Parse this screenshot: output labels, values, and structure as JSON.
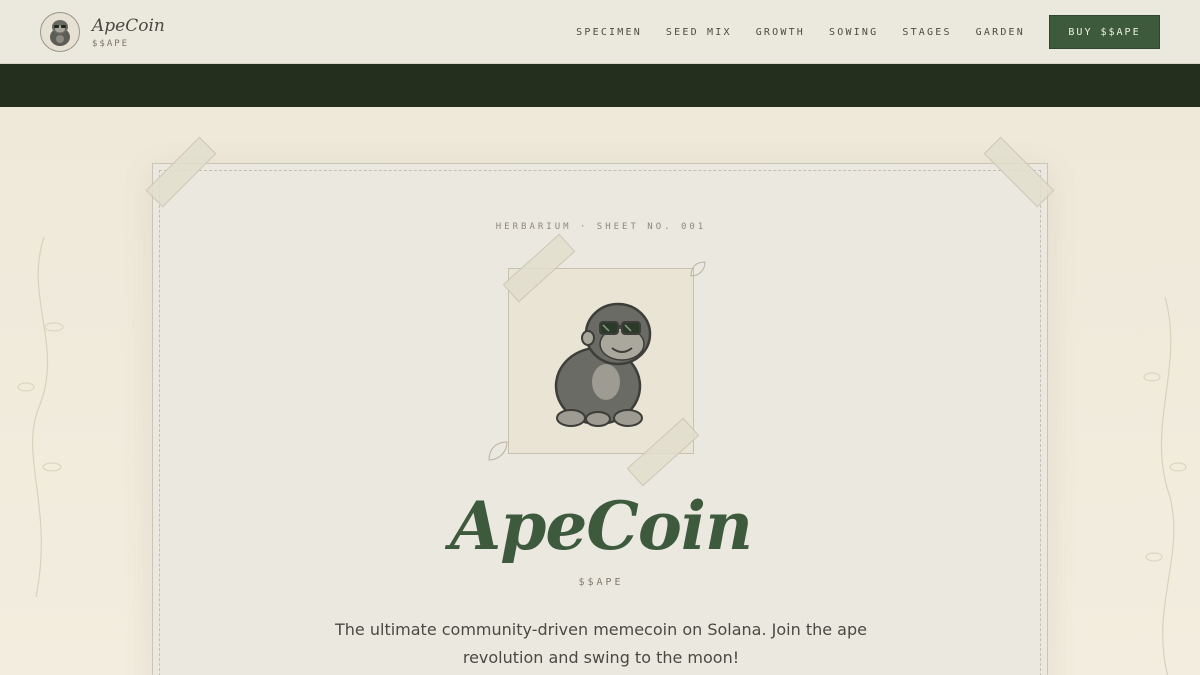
{
  "brand": {
    "name": "ApeCoin",
    "ticker": "$$APE"
  },
  "nav": {
    "links": [
      "SPECIMEN",
      "SEED MIX",
      "GROWTH",
      "SOWING",
      "STAGES",
      "GARDEN"
    ],
    "buy_label": "BUY $$APE"
  },
  "hero": {
    "eyebrow": "HERBARIUM · SHEET NO. 001",
    "title": "ApeCoin",
    "ticker": "$$APE",
    "description": "The ultimate community-driven memecoin on Solana. Join the ape revolution and swing to the moon!"
  },
  "icons": [
    "gorilla-logo-icon",
    "gorilla-mascot-icon",
    "leaf-icon"
  ],
  "colors": {
    "accent": "#3e5a3d",
    "dark_band": "#24301d",
    "paper": "#ebe8df"
  }
}
